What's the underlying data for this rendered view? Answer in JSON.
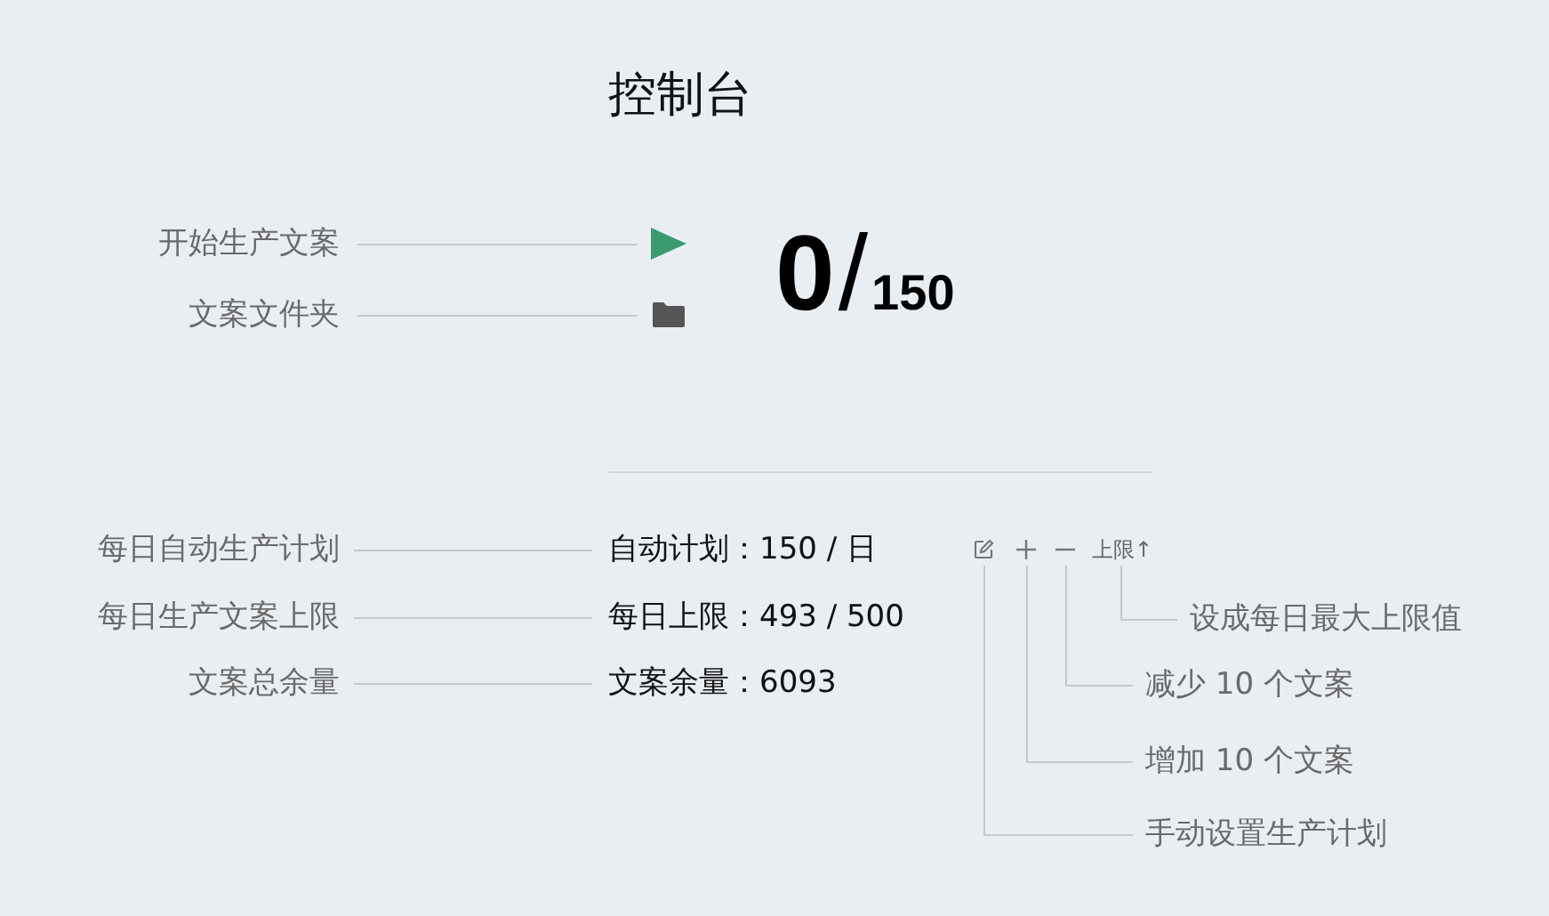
{
  "title": "控制台",
  "actions": [
    {
      "kind": "start",
      "label": "开始生产文案"
    },
    {
      "kind": "folder",
      "label": "文案文件夹"
    }
  ],
  "counter": {
    "done": "0",
    "separator": "/",
    "total": "150"
  },
  "stats": [
    {
      "label": "每日自动生产计划",
      "value": "自动计划：150 / 日"
    },
    {
      "label": "每日生产文案上限",
      "value": "每日上限：493 / 500"
    },
    {
      "label": "文案总余量",
      "value": "文案余量：6093"
    }
  ],
  "plan_controls": [
    {
      "kind": "edit"
    },
    {
      "kind": "plus"
    },
    {
      "kind": "minus"
    },
    {
      "kind": "max",
      "text": "上限↑"
    }
  ],
  "control_notes": [
    "设成每日最大上限值",
    "减少 10 个文案",
    "增加 10 个文案",
    "手动设置生产计划"
  ]
}
